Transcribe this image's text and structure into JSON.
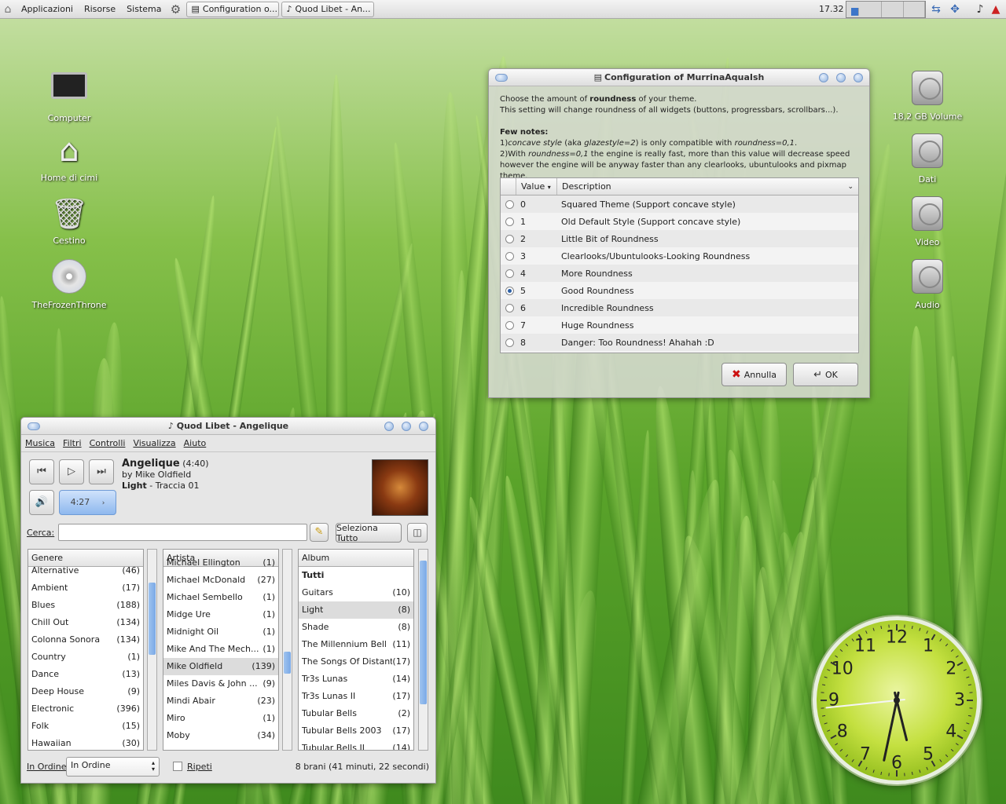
{
  "panel": {
    "menus": [
      "Applicazioni",
      "Risorse",
      "Sistema"
    ],
    "tasks": [
      "Configuration o...",
      "Quod Libet - An..."
    ],
    "time": "17.32"
  },
  "desktop": {
    "left_icons": [
      "Computer",
      "Home di cimi",
      "Cestino",
      "TheFrozenThrone"
    ],
    "right_icons": [
      "18,2 GB Volume",
      "Dati",
      "Video",
      "Audio"
    ]
  },
  "config": {
    "title": "Configuration of MurrinaAquaIsh",
    "intro_pre": "Choose the amount of ",
    "intro_bold": "roundness",
    "intro_post": " of your theme.",
    "intro2": "This setting will change roundness of all widgets (buttons, progressbars, scrollbars...).",
    "notes_title": "Few notes:",
    "note1_a": "1)",
    "note1_i": "concave style",
    "note1_b": " (aka ",
    "note1_i2": "glazestyle=2",
    "note1_c": ") is only compatible with ",
    "note1_i3": "roundness=0,1",
    ".": ".",
    "note2_a": "2)With ",
    "note2_i": "roundness=0,1",
    "note2_b": " the engine is really fast, more than this value will decrease speed",
    "note3": "however the engine will be anyway faster than any clearlooks, ubuntulooks and pixmap theme.",
    "col_value": "Value",
    "col_desc": "Description",
    "rows": [
      {
        "v": "0",
        "d": "Squared Theme (Support concave style)"
      },
      {
        "v": "1",
        "d": "Old Default Style (Support concave style)"
      },
      {
        "v": "2",
        "d": "Little Bit of Roundness"
      },
      {
        "v": "3",
        "d": "Clearlooks/Ubuntulooks-Looking Roundness"
      },
      {
        "v": "4",
        "d": "More Roundness"
      },
      {
        "v": "5",
        "d": "Good Roundness"
      },
      {
        "v": "6",
        "d": "Incredible Roundness"
      },
      {
        "v": "7",
        "d": "Huge Roundness"
      },
      {
        "v": "8",
        "d": "Danger: Too Roundness! Ahahah :D"
      }
    ],
    "selected": "5",
    "cancel": "Annulla",
    "ok": "OK"
  },
  "ql": {
    "title": "Quod Libet - Angelique",
    "menu": [
      "Musica",
      "Filtri",
      "Controlli",
      "Visualizza",
      "Aiuto"
    ],
    "song_title": "Angelique",
    "song_len": "(4:40)",
    "artist": "by Mike Oldfield",
    "album": "Light",
    "track": " - Traccia 01",
    "position": "4:27",
    "search_label": "Cerca:",
    "select_all": "Seleziona Tutto",
    "genre_header": "Genere",
    "artist_header": "Artista",
    "album_header": "Album",
    "genres": [
      [
        "Alternative",
        "(46)"
      ],
      [
        "Ambient",
        "(17)"
      ],
      [
        "Blues",
        "(188)"
      ],
      [
        "Chill Out",
        "(134)"
      ],
      [
        "Colonna Sonora",
        "(134)"
      ],
      [
        "Country",
        "(1)"
      ],
      [
        "Dance",
        "(13)"
      ],
      [
        "Deep House",
        "(9)"
      ],
      [
        "Electronic",
        "(396)"
      ],
      [
        "Folk",
        "(15)"
      ],
      [
        "Hawaiian",
        "(30)"
      ]
    ],
    "artists": [
      [
        "Michael Ellington",
        "(1)"
      ],
      [
        "Michael McDonald",
        "(27)"
      ],
      [
        "Michael Sembello",
        "(1)"
      ],
      [
        "Midge Ure",
        "(1)"
      ],
      [
        "Midnight Oil",
        "(1)"
      ],
      [
        "Mike And The Mech...",
        "(1)"
      ],
      [
        "Mike Oldfield",
        "(139)"
      ],
      [
        "Miles Davis & John ...",
        "(9)"
      ],
      [
        "Mindi Abair",
        "(23)"
      ],
      [
        "Miro",
        "(1)"
      ],
      [
        "Moby",
        "(34)"
      ]
    ],
    "albums": [
      [
        "Tutti",
        ""
      ],
      [
        "Guitars",
        "(10)"
      ],
      [
        "Light",
        "(8)"
      ],
      [
        "Shade",
        "(8)"
      ],
      [
        "The Millennium Bell",
        "(11)"
      ],
      [
        "The Songs Of Distant...",
        "(17)"
      ],
      [
        "Tr3s Lunas",
        "(14)"
      ],
      [
        "Tr3s Lunas II",
        "(17)"
      ],
      [
        "Tubular Bells",
        "(2)"
      ],
      [
        "Tubular Bells 2003",
        "(17)"
      ],
      [
        "Tubular Bells II",
        "(14)"
      ]
    ],
    "order_label": "In Ordine",
    "order_value": "In Ordine",
    "repeat": "Ripeti",
    "status": "8 brani (41 minuti, 22 secondi)"
  },
  "clock": {
    "numbers": [
      "12",
      "1",
      "2",
      "3",
      "4",
      "5",
      "6",
      "7",
      "8",
      "9",
      "10",
      "11"
    ],
    "hour": 5,
    "minute": 32,
    "second": 44
  }
}
